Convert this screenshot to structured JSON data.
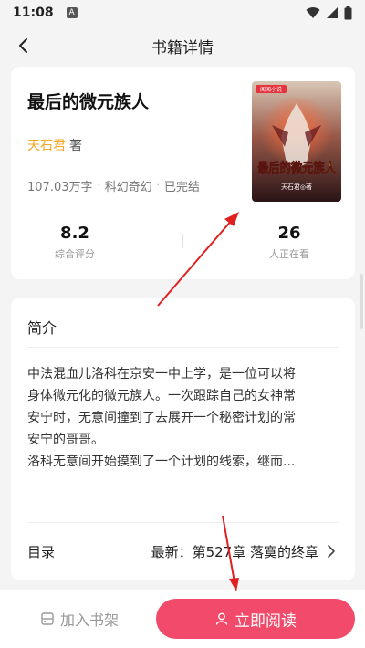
{
  "status_bar": {
    "time": "11:08",
    "notice_glyph": "A"
  },
  "header": {
    "title": "书籍详情"
  },
  "book": {
    "title": "最后的微元族人",
    "author": "天石君",
    "author_suffix": "著",
    "word_count": "107.03万字",
    "genre": "科幻奇幻",
    "status": "已完结",
    "cover": {
      "publisher_badge": "阅阅小说",
      "cover_title": "最后的微元族人",
      "cover_author": "天石君◎著"
    }
  },
  "stats": [
    {
      "value": "8.2",
      "label": "综合评分"
    },
    {
      "value": "26",
      "label": "人正在看"
    }
  ],
  "intro": {
    "heading": "简介",
    "text_lines": [
      "中法混血儿洛科在京安一中上学，是一位可以将",
      "身体微元化的微元族人。一次跟踪自己的女神常",
      "安宁时，无意间撞到了去展开一个秘密计划的常",
      "安宁的哥哥。",
      "洛科无意间开始摸到了一个计划的线索，继而..."
    ]
  },
  "toc": {
    "label": "目录",
    "latest": "最新：第527章 落寞的终章"
  },
  "bottom": {
    "shelf_label": "加入书架",
    "read_label": "立即阅读"
  },
  "colors": {
    "accent": "#f24a6a",
    "author": "#f5a623",
    "annotation_arrow": "#e02020"
  },
  "icons": [
    "back-arrow-icon",
    "wifi-icon",
    "signal-icon",
    "battery-icon",
    "chevron-right-icon",
    "bookshelf-icon",
    "reader-icon"
  ]
}
